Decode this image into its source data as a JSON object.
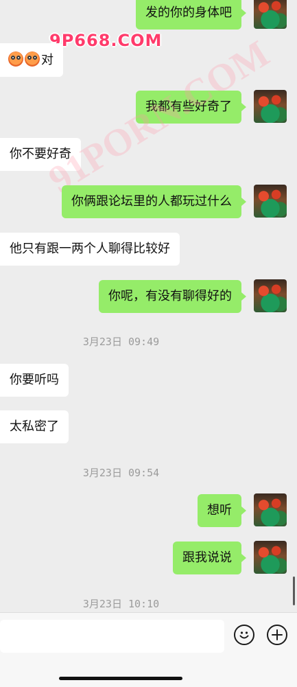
{
  "watermark": {
    "text": "9P668.COM",
    "diagonal": "91PORN.COM"
  },
  "messages": [
    {
      "side": "out",
      "text": "发的你的身体吧"
    },
    {
      "side": "in",
      "text": "对"
    },
    {
      "side": "out",
      "text": "我都有些好奇了"
    },
    {
      "side": "in",
      "text": "你不要好奇"
    },
    {
      "side": "out",
      "text": "你俩跟论坛里的人都玩过什么"
    },
    {
      "side": "in",
      "text": "他只有跟一两个人聊得比较好"
    },
    {
      "side": "out",
      "text": "你呢，有没有聊得好的"
    },
    {
      "side": "time",
      "text": "3月23日 09:49"
    },
    {
      "side": "in",
      "text": "你要听吗"
    },
    {
      "side": "in",
      "text": "太私密了"
    },
    {
      "side": "time",
      "text": "3月23日 09:54"
    },
    {
      "side": "out",
      "text": "想听"
    },
    {
      "side": "out",
      "text": "跟我说说"
    },
    {
      "side": "time",
      "text": "3月23日 10:10"
    }
  ],
  "input": {
    "value": "",
    "placeholder": ""
  },
  "icons": {
    "emoji": "emoji-icon",
    "plus": "plus-icon"
  }
}
